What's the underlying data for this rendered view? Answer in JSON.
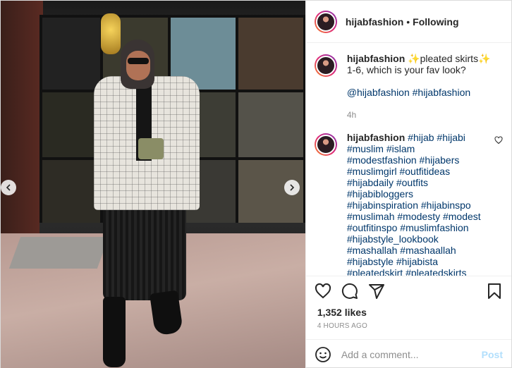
{
  "post": {
    "username": "hijabfashion",
    "follow_separator": "•",
    "follow_state": "Following"
  },
  "caption": {
    "username": "hijabfashion",
    "text_line1": "✨pleated skirts✨",
    "text_line2": "1-6, which is your fav look?",
    "mentions": "@hijabfashion #hijabfashion",
    "age": "4h"
  },
  "comment": {
    "username": "hijabfashion",
    "lines": [
      "#hijab #hijabi",
      "#muslim #islam",
      "#modestfashion #hijabers",
      "#muslimgirl #outfitideas",
      "#hijabdaily #outfits",
      "#hijabibloggers",
      "#hijabinspiration #hijabinspo",
      "#muslimah #modesty #modest",
      "#outfitinspo #muslimfashion",
      "#hijabstyle_lookbook",
      "#mashallah #mashaallah",
      "#hijabstyle #hijabista",
      "#pleatedskirt #pleatedskirts"
    ]
  },
  "stats": {
    "likes": "1,352 likes",
    "timestamp": "4 HOURS AGO"
  },
  "composer": {
    "placeholder": "Add a comment...",
    "post_label": "Post"
  },
  "colors": {
    "link": "#00376b",
    "muted": "#8e8e8e",
    "post_disabled": "#b2dffc"
  }
}
